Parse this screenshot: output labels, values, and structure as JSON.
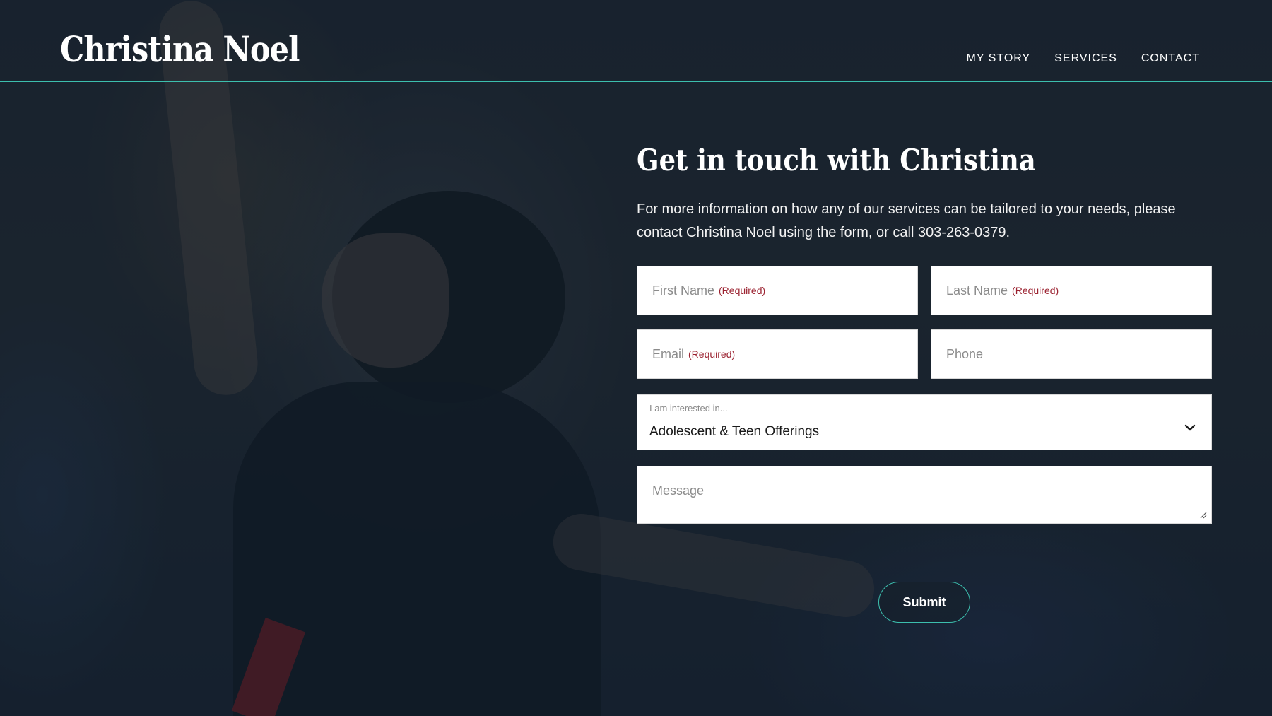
{
  "site": {
    "logo": "Christina Noel",
    "nav": [
      {
        "label": "MY STORY"
      },
      {
        "label": "SERVICES"
      },
      {
        "label": "CONTACT"
      }
    ]
  },
  "contact": {
    "heading": "Get in touch with Christina",
    "intro": "For more information on how any of our services can be tailored to your needs, please contact Christina Noel using the form, or call 303-263-0379.",
    "fields": {
      "first_name": {
        "placeholder": "First Name",
        "required": "(Required)"
      },
      "last_name": {
        "placeholder": "Last Name",
        "required": "(Required)"
      },
      "email": {
        "placeholder": "Email",
        "required": "(Required)"
      },
      "phone": {
        "placeholder": "Phone"
      },
      "interest": {
        "label": "I am interested in...",
        "value": "Adolescent & Teen Offerings"
      },
      "message": {
        "placeholder": "Message"
      }
    },
    "submit_label": "Submit"
  },
  "colors": {
    "accent": "#3cbfae",
    "required": "#9b2230",
    "background": "#1a2431"
  }
}
